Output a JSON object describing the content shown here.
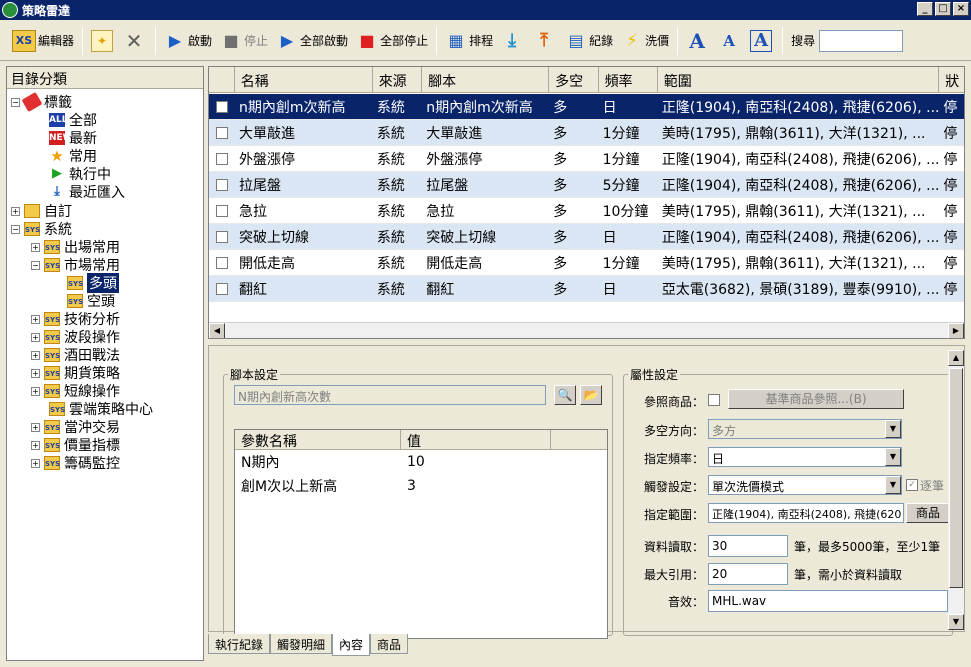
{
  "window": {
    "title": "策略雷達"
  },
  "toolbar": {
    "editor": "編輯器",
    "start": "啟動",
    "stop": "停止",
    "start_all": "全部啟動",
    "stop_all": "全部停止",
    "schedule": "排程",
    "record": "紀錄",
    "wash_price": "洗價",
    "search_label": "搜尋",
    "search_value": "",
    "editor_logo": "XS"
  },
  "tree": {
    "header": "目錄分類",
    "items": [
      {
        "label": "標籤"
      },
      {
        "label": "全部"
      },
      {
        "label": "最新"
      },
      {
        "label": "常用"
      },
      {
        "label": "執行中"
      },
      {
        "label": "最近匯入"
      },
      {
        "label": "自訂"
      },
      {
        "label": "系統"
      },
      {
        "label": "出場常用"
      },
      {
        "label": "市場常用"
      },
      {
        "label": "多頭"
      },
      {
        "label": "空頭"
      },
      {
        "label": "技術分析"
      },
      {
        "label": "波段操作"
      },
      {
        "label": "酒田戰法"
      },
      {
        "label": "期貨策略"
      },
      {
        "label": "短線操作"
      },
      {
        "label": "雲端策略中心"
      },
      {
        "label": "當沖交易"
      },
      {
        "label": "價量指標"
      },
      {
        "label": "籌碼監控"
      }
    ]
  },
  "grid": {
    "columns": [
      "名稱",
      "來源",
      "腳本",
      "多空",
      "頻率",
      "範圍",
      "狀"
    ],
    "rows": [
      {
        "name": "n期內創m次新高",
        "source": "系統",
        "script": "n期內創m次新高",
        "dir": "多",
        "freq": "日",
        "range": "正隆(1904), 南亞科(2408), 飛捷(6206), ...",
        "status": "停"
      },
      {
        "name": "大單敲進",
        "source": "系統",
        "script": "大單敲進",
        "dir": "多",
        "freq": "1分鐘",
        "range": "美時(1795), 鼎翰(3611), 大洋(1321), ...",
        "status": "停"
      },
      {
        "name": "外盤漲停",
        "source": "系統",
        "script": "外盤漲停",
        "dir": "多",
        "freq": "1分鐘",
        "range": "正隆(1904), 南亞科(2408), 飛捷(6206), ...",
        "status": "停"
      },
      {
        "name": "拉尾盤",
        "source": "系統",
        "script": "拉尾盤",
        "dir": "多",
        "freq": "5分鐘",
        "range": "正隆(1904), 南亞科(2408), 飛捷(6206), ...",
        "status": "停"
      },
      {
        "name": "急拉",
        "source": "系統",
        "script": "急拉",
        "dir": "多",
        "freq": "10分鐘",
        "range": "美時(1795), 鼎翰(3611), 大洋(1321), ...",
        "status": "停"
      },
      {
        "name": "突破上切線",
        "source": "系統",
        "script": "突破上切線",
        "dir": "多",
        "freq": "日",
        "range": "正隆(1904), 南亞科(2408), 飛捷(6206), ...",
        "status": "停"
      },
      {
        "name": "開低走高",
        "source": "系統",
        "script": "開低走高",
        "dir": "多",
        "freq": "1分鐘",
        "range": "美時(1795), 鼎翰(3611), 大洋(1321), ...",
        "status": "停"
      },
      {
        "name": "翻紅",
        "source": "系統",
        "script": "翻紅",
        "dir": "多",
        "freq": "日",
        "range": "亞太電(3682), 景碩(3189), 豐泰(9910), ...",
        "status": "停"
      }
    ]
  },
  "script_settings": {
    "legend": "腳本設定",
    "script_name": "N期內創新高次數",
    "param_headers": [
      "參數名稱",
      "值"
    ],
    "params": [
      {
        "name": "N期內",
        "value": "10"
      },
      {
        "name": "創M次以上新高",
        "value": "3"
      }
    ]
  },
  "props": {
    "legend": "屬性設定",
    "ref_label": "參照商品：",
    "ref_button": "基準商品參照...(B)",
    "dir_label": "多空方向：",
    "dir_value": "多方",
    "freq_label": "指定頻率：",
    "freq_value": "日",
    "trigger_label": "觸發設定：",
    "trigger_value": "單次洗價模式",
    "trigger_check": "逐筆",
    "range_label": "指定範圍：",
    "range_value": "正隆(1904), 南亞科(2408), 飛捷(620",
    "range_button": "商品",
    "read_label": "資料讀取：",
    "read_value": "30",
    "read_hint": "筆，最多5000筆，至少1筆",
    "ref_max_label": "最大引用：",
    "ref_max_value": "20",
    "ref_max_hint": "筆，需小於資料讀取",
    "sound_label": "音效：",
    "sound_value": "MHL.wav"
  },
  "tabs": [
    "執行紀錄",
    "觸發明細",
    "內容",
    "商品"
  ]
}
